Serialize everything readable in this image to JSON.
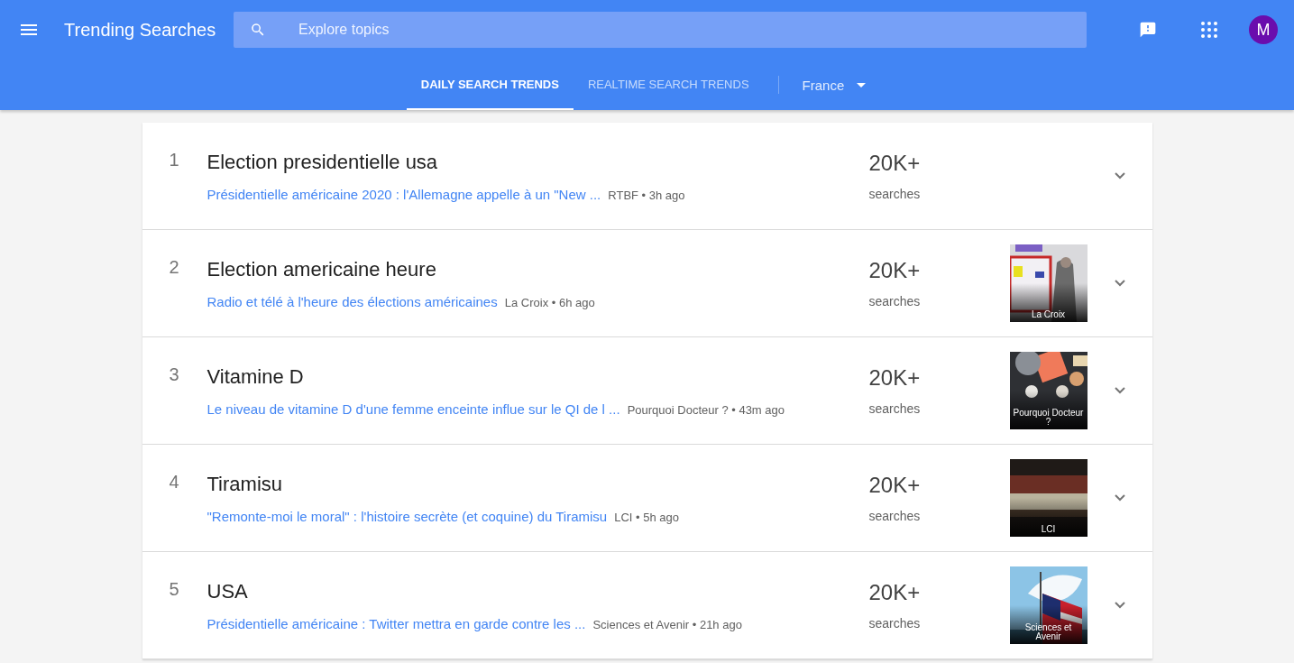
{
  "header": {
    "title": "Trending Searches",
    "search": {
      "placeholder": "Explore topics"
    },
    "avatar": "M"
  },
  "tabs": [
    {
      "label": "DAILY SEARCH TRENDS",
      "selected": true
    },
    {
      "label": "REALTIME SEARCH TRENDS",
      "selected": false
    }
  ],
  "country": "France",
  "trends": [
    {
      "rank": "1",
      "title": "Election presidentielle usa",
      "article": "Présidentielle américaine 2020 : l'Allemagne appelle à un \"New ...",
      "source": "RTBF • 3h ago",
      "count": "20K+",
      "count_label": "searches"
    },
    {
      "rank": "2",
      "title": "Election americaine heure",
      "article": "Radio et télé à l'heure des élections américaines",
      "source": "La Croix • 6h ago",
      "count": "20K+",
      "count_label": "searches",
      "thumbnail": {
        "kind": "picture",
        "caption": "La Croix"
      }
    },
    {
      "rank": "3",
      "title": "Vitamine D",
      "article": "Le niveau de vitamine D d'une femme enceinte influe sur le QI de l ...",
      "source": "Pourquoi Docteur ? • 43m ago",
      "count": "20K+",
      "count_label": "searches",
      "thumbnail": {
        "kind": "picture",
        "caption": "Pourquoi Docteur ?"
      }
    },
    {
      "rank": "4",
      "title": "Tiramisu",
      "article": "\"Remonte-moi le moral\" : l'histoire secrète (et coquine) du Tiramisu",
      "source": "LCI • 5h ago",
      "count": "20K+",
      "count_label": "searches",
      "thumbnail": {
        "kind": "picture",
        "caption": "LCI"
      }
    },
    {
      "rank": "5",
      "title": "USA",
      "article": "Présidentielle américaine : Twitter mettra en garde contre les ...",
      "source": "Sciences et Avenir • 21h ago",
      "count": "20K+",
      "count_label": "searches",
      "thumbnail": {
        "kind": "picture",
        "caption": "Sciences et Avenir"
      }
    }
  ]
}
